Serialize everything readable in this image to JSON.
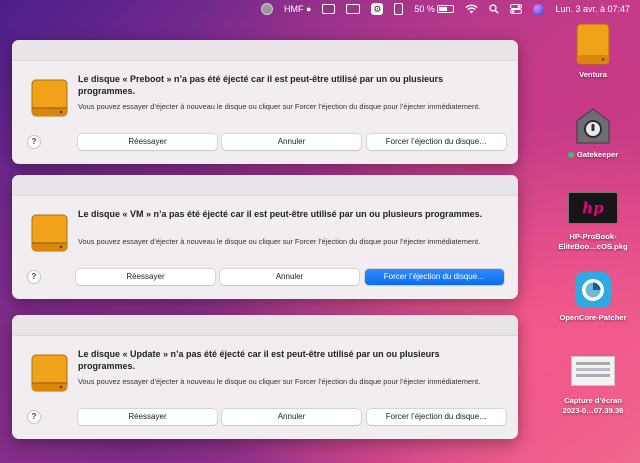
{
  "menubar": {
    "app_label": "HMF",
    "battery": "50 %",
    "datetime": "Lun. 3 avr. à 07:47"
  },
  "dialogs": [
    {
      "title": "Le disque « Preboot » n’a pas été éjecté car il est peut-être utilisé par un ou plusieurs programmes.",
      "desc": "Vous pouvez essayer d’éjecter à nouveau le disque ou cliquer sur Forcer l’éjection du disque pour l’éjecter immédiatement.",
      "retry": "Réessayer",
      "cancel": "Annuler",
      "force": "Forcer l’éjection du disque…",
      "help": "?"
    },
    {
      "title": "Le disque « VM » n’a pas été éjecté car il est peut-être utilisé par un ou plusieurs programmes.",
      "desc": "Vous pouvez essayer d’éjecter à nouveau le disque ou cliquer sur Forcer l’éjection du disque pour l’éjecter immédiatement.",
      "retry": "Réessayer",
      "cancel": "Annuler",
      "force": "Forcer l’éjection du disque…",
      "help": "?"
    },
    {
      "title": "Le disque « Update » n’a pas été éjecté car il est peut-être utilisé par un ou plusieurs programmes.",
      "desc": "Vous pouvez essayer d’éjecter à nouveau le disque ou cliquer sur Forcer l’éjection du disque pour l’éjecter immédiatement.",
      "retry": "Réessayer",
      "cancel": "Annuler",
      "force": "Forcer l’éjection du disque…",
      "help": "?"
    }
  ],
  "desktop": {
    "ventura": "Ventura",
    "gatekeeper": "Gatekeeper",
    "hp_line1": "HP-ProBook-",
    "hp_line2": "EliteBoo…cOS.pkg",
    "hp_logo": "hp",
    "opencore": "OpenCore-Patcher",
    "capture_line1": "Capture d’écran",
    "capture_line2": "2023-0…07.39.36"
  },
  "colors": {
    "accent": "#0a6df0",
    "disk_orange": "#f0a21a"
  }
}
